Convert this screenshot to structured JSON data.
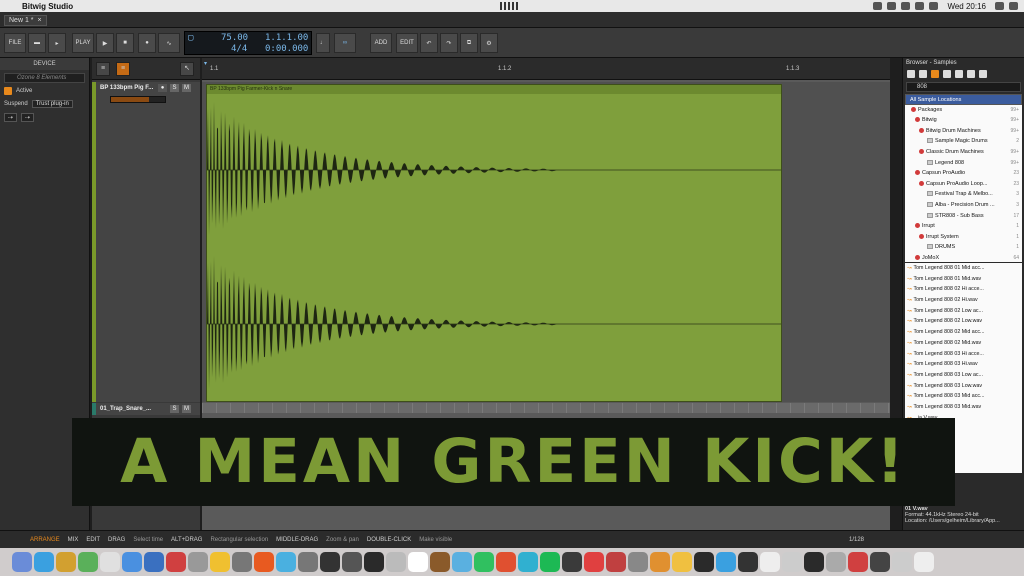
{
  "menubar": {
    "app_name": "Bitwig Studio",
    "clock": "Wed 20:16"
  },
  "tabbar": {
    "document_tab": "New 1 *"
  },
  "transport": {
    "file_label": "FILE",
    "play_label": "PLAY",
    "add_label": "ADD",
    "edit_label": "EDIT",
    "tempo": "75.00",
    "time_signature": "4/4",
    "position": "1.1.1.00",
    "time": "0:00.000"
  },
  "device_panel": {
    "header": "DEVICE",
    "preset_placeholder": "Ozone 8 Elements",
    "active_label": "Active",
    "suspend_label": "Suspend",
    "suspend_value": "Trust plug-in"
  },
  "tracks": [
    {
      "name": "BP 133bpm Pig F...",
      "solo": "S",
      "mute": "M"
    },
    {
      "name": "01_Trap_Snare_...",
      "solo": "S",
      "mute": "M"
    }
  ],
  "ruler": {
    "marker_1": "1.1",
    "marker_2": "1.1.2",
    "marker_3": "1.1.3"
  },
  "clip": {
    "title": "BP 133bpm Pig Farmer-Kick n Snare"
  },
  "browser": {
    "title": "Browser - Samples",
    "search_value": "808",
    "tree": [
      {
        "label": "All Sample Locations",
        "count": "",
        "selected": true
      },
      {
        "label": "Packages",
        "count": "99+"
      },
      {
        "label": "Bitwig",
        "count": "99+"
      },
      {
        "label": "Bitwig Drum Machines",
        "count": "99+"
      },
      {
        "label": "Sample Magic Drums",
        "count": "2"
      },
      {
        "label": "Classic Drum Machines",
        "count": "99+"
      },
      {
        "label": "Legend 808",
        "count": "99+"
      },
      {
        "label": "Capsun ProAudio",
        "count": "23"
      },
      {
        "label": "Capsun ProAudio Loop...",
        "count": "23"
      },
      {
        "label": "Festival Trap & Melbo...",
        "count": "3"
      },
      {
        "label": "Alba - Precision Drum ...",
        "count": "3"
      },
      {
        "label": "STR808 - Sub Bass",
        "count": "17"
      },
      {
        "label": "Irrupt",
        "count": "1"
      },
      {
        "label": "Irrupt System",
        "count": "1"
      },
      {
        "label": "DRUMS",
        "count": "1"
      },
      {
        "label": "JoMoX",
        "count": "64"
      }
    ],
    "results": [
      "Tom Legend 808 01 Mid acc...",
      "Tom Legend 808 01 Mid.wav",
      "Tom Legend 808 02 Hi acce...",
      "Tom Legend 808 02 Hi.wav",
      "Tom Legend 808 02 Low ac...",
      "Tom Legend 808 02 Low.wav",
      "Tom Legend 808 02 Mid acc...",
      "Tom Legend 808 02 Mid.wav",
      "Tom Legend 808 03 Hi acce...",
      "Tom Legend 808 03 Hi.wav",
      "Tom Legend 808 03 Low ac...",
      "Tom Legend 808 03 Low.wav",
      "Tom Legend 808 03 Mid acc...",
      "Tom Legend 808 03 Mid.wav",
      "...ia V.wav",
      "...ners2.wav",
      "...bon.wav",
      "...cky V.wav",
      "...ssh01 V.wav"
    ],
    "preview_name": "01 V.wav",
    "format": "Format: 44.1kHz Stereo 24-bit",
    "location": "Location: /Users/gelheim/Library/App..."
  },
  "banner": {
    "text": "A MEAN GREEN KICK!"
  },
  "footer": {
    "arrange": "ARRANGE",
    "mix": "MIX",
    "edit": "EDIT",
    "hint1_key": "DRAG",
    "hint1_val": "Select time",
    "hint2_key": "ALT+DRAG",
    "hint2_val": "Rectangular selection",
    "hint3_key": "MIDDLE-DRAG",
    "hint3_val": "Zoom & pan",
    "hint4_key": "DOUBLE-CLICK",
    "hint4_val": "Make visible",
    "zoom": "1/128"
  }
}
